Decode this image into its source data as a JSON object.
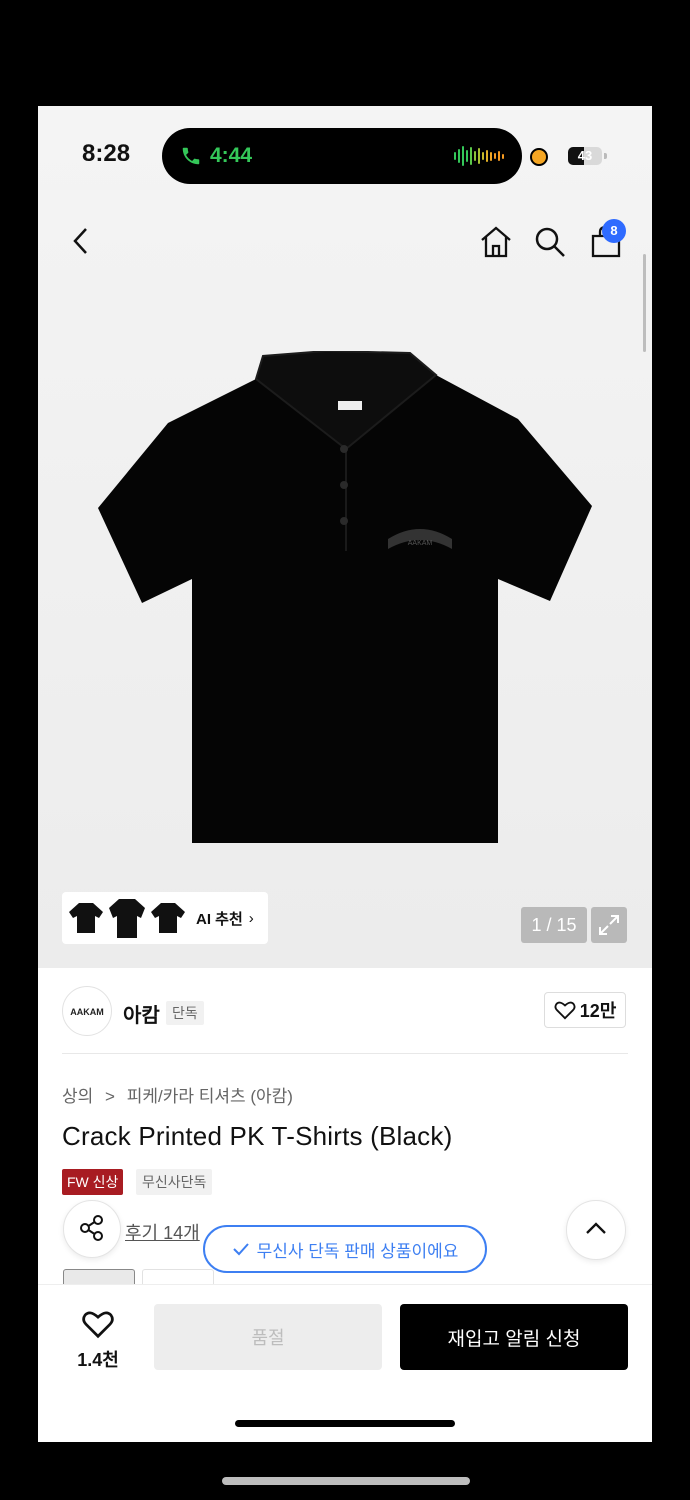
{
  "status_bar": {
    "time": "8:28",
    "call_time": "4:44",
    "battery": "43"
  },
  "header": {
    "cart_count": "8"
  },
  "gallery": {
    "ai_label": "AI 추천",
    "pager": "1 / 15",
    "logo_text": "AAKAM"
  },
  "brand": {
    "logo": "AAKAM",
    "name": "아캄",
    "exclusive_tag": "단독",
    "likes": "12만"
  },
  "breadcrumb": {
    "category": "상의",
    "separator": ">",
    "subcategory": "피케/카라 티셔츠 (아캄)"
  },
  "product": {
    "title": "Crack Printed PK T-Shirts (Black)",
    "tags": {
      "fw_new": "FW 신상",
      "musinsa_exclusive": "무신사단독"
    },
    "reviews": "후기 14개"
  },
  "toast": {
    "text": "무신사 단독 판매 상품이에요"
  },
  "bottom_bar": {
    "wish_count": "1.4천",
    "soldout_label": "품절",
    "restock_label": "재입고 알림 신청"
  },
  "icons": [
    "back-icon",
    "home-icon",
    "search-icon",
    "cart-icon",
    "expand-icon",
    "heart-icon",
    "share-icon",
    "chevron-up-icon",
    "check-icon",
    "phone-icon"
  ],
  "colors": {
    "accent_blue": "#3d7ff2",
    "badge_blue": "#2f6bff",
    "fw_tag_red": "#a81c22",
    "call_green": "#34c759",
    "restock_button": "#000000"
  }
}
